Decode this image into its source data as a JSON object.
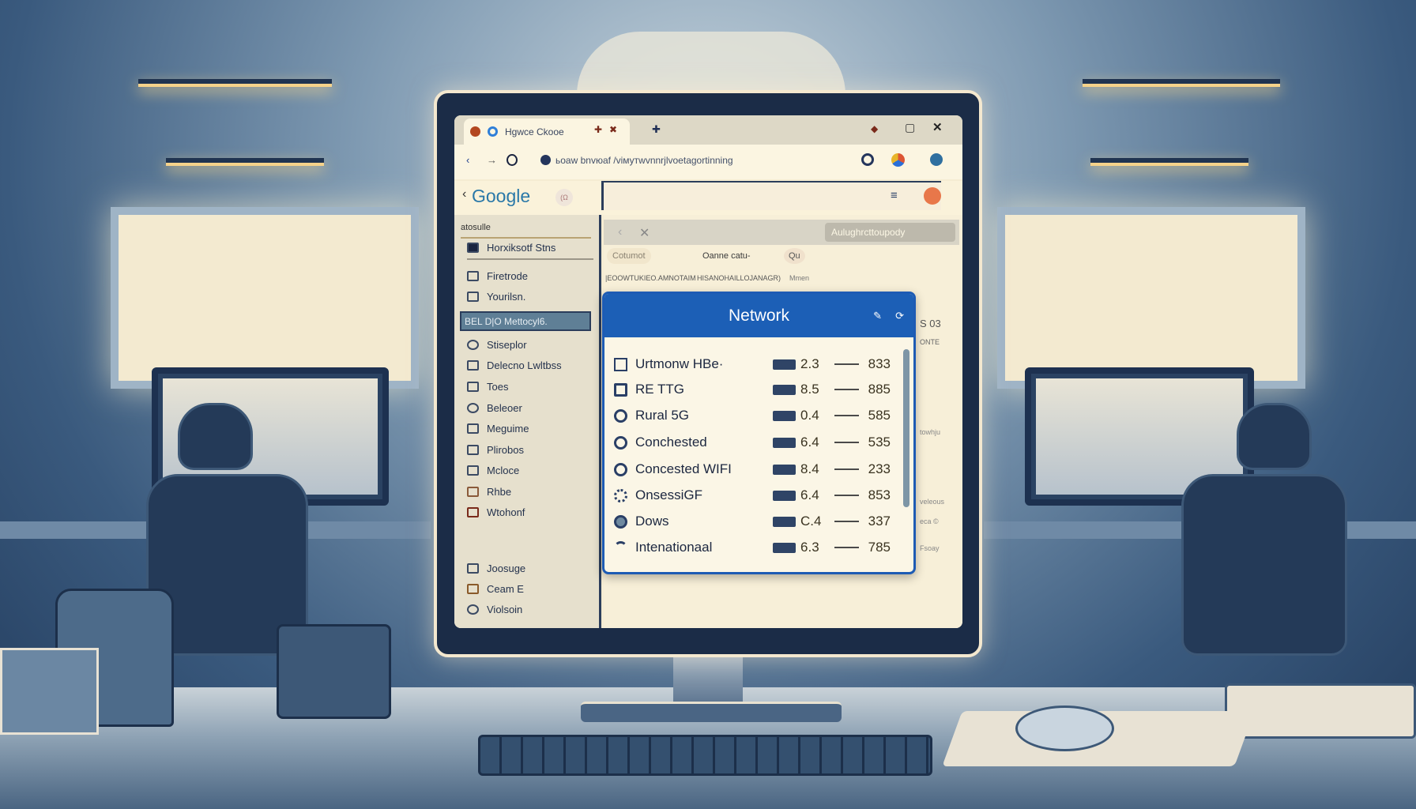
{
  "browser": {
    "tab_title": "Hgwce Ckooe",
    "address": "ьоаw bnvюaf /viмутwvnnrjlvoetagortinning",
    "google_logo": "Google",
    "google_badge": "(Ω"
  },
  "sidebar": {
    "header": "atosulle",
    "top_item": "Horхiksotf Stns",
    "items": [
      {
        "label": "Firetrode",
        "icon": "document-icon"
      },
      {
        "label": "Yourilsn.",
        "icon": "square-icon"
      },
      {
        "label": "BEL D|O Mettocyl6.",
        "icon": "network-icon",
        "selected": true
      },
      {
        "label": "Stiseplor",
        "icon": "circle-icon"
      },
      {
        "label": "Delecno Lwltbss",
        "icon": "bars-icon"
      },
      {
        "label": "Toes",
        "icon": "box-icon"
      },
      {
        "label": "Beleoer",
        "icon": "circle-icon"
      },
      {
        "label": "Meguime",
        "icon": "list-icon"
      },
      {
        "label": "Plirobos",
        "icon": "list-icon"
      },
      {
        "label": "Mcloce",
        "icon": "list-icon"
      },
      {
        "label": "Rhbe",
        "icon": "list-icon"
      },
      {
        "label": "Wtohonf",
        "icon": "flag-icon"
      }
    ],
    "bottom_items": [
      {
        "label": "Joosuge",
        "icon": "badge-icon"
      },
      {
        "label": "Ceam E",
        "icon": "list-icon"
      },
      {
        "label": "Violsoin",
        "icon": "circle-icon"
      }
    ]
  },
  "main": {
    "toolbar_button": "Aulughrcttoupody",
    "filter_chip": "Cotumot",
    "filter_label": "Oanne catu-",
    "filter_badge": "Qu",
    "subheader_cols": [
      "|EOOWTUKIEO.AMNOTAIM",
      "HISANOHAILLOJANAGR)",
      "Mmen"
    ],
    "side_text": [
      "S 03",
      "ONTE",
      "towhju",
      "veleous",
      "eca ©",
      "Fsoay"
    ]
  },
  "modal": {
    "title": "Network",
    "rows": [
      {
        "name": "Urtmonw HBe·",
        "value": "2.3",
        "count": "833"
      },
      {
        "name": "RE TTG",
        "value": "8.5",
        "count": "885"
      },
      {
        "name": "Rural 5G",
        "value": "0.4",
        "count": "585"
      },
      {
        "name": "Conchested",
        "value": "6.4",
        "count": "535"
      },
      {
        "name": "Concested WIFI",
        "value": "8.4",
        "count": "233"
      },
      {
        "name": "OnsessiGF",
        "value": "6.4",
        "count": "853"
      },
      {
        "name": "Dows",
        "value": "C.4",
        "count": "337"
      },
      {
        "name": "Intenationaal",
        "value": "6.3",
        "count": "785"
      }
    ]
  },
  "colors": {
    "accent": "#1c5fb6",
    "sidebar_selected": "#5f7f96",
    "screen_bg": "#f5ecd2"
  }
}
